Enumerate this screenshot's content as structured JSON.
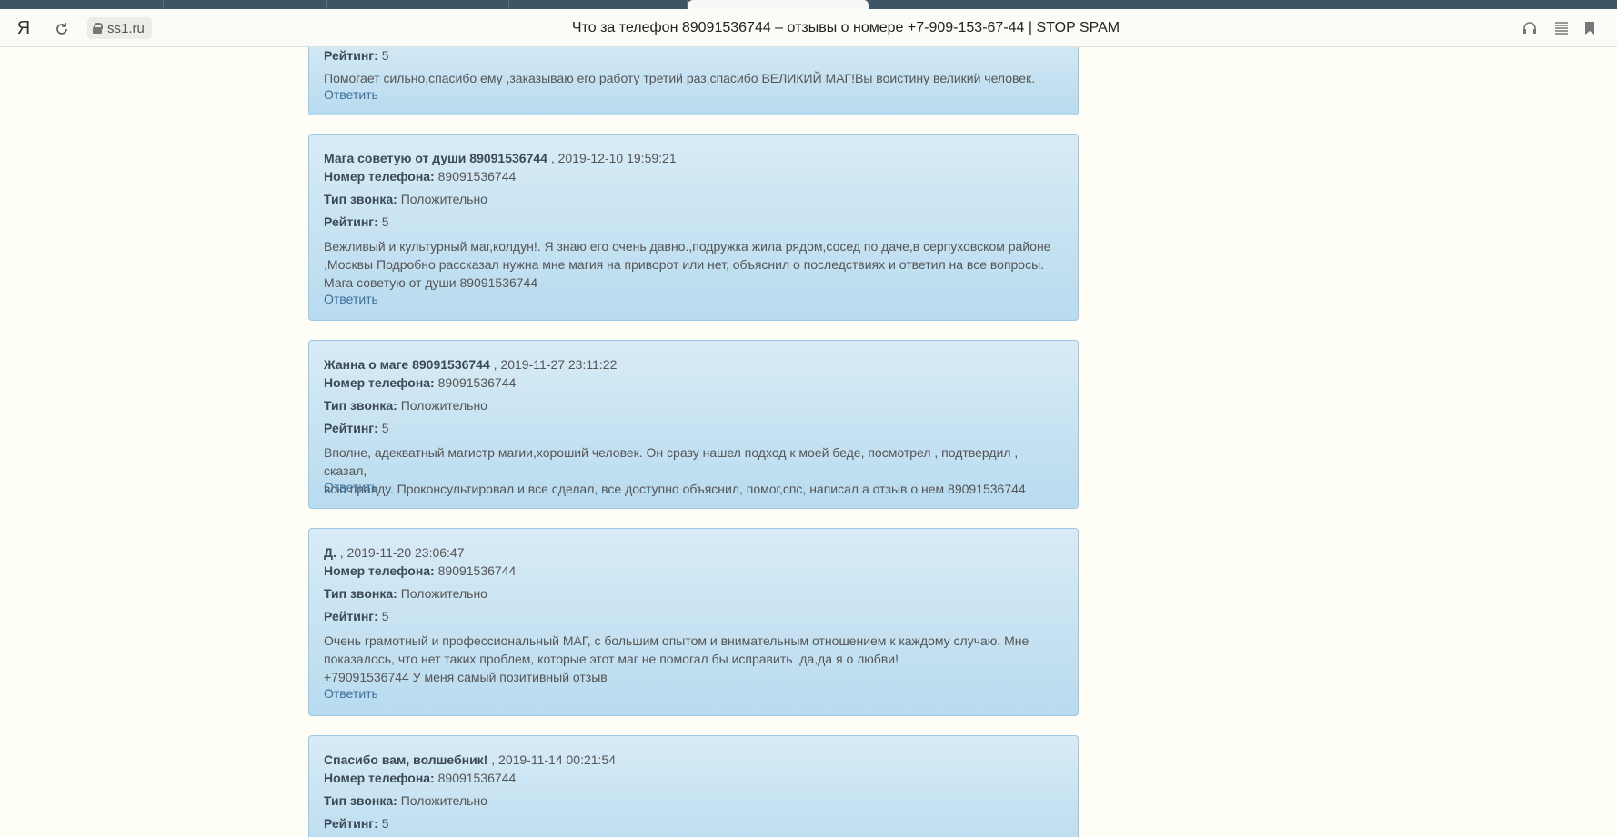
{
  "browser": {
    "logo": "Я",
    "url": "ss1.ru",
    "title": "Что за телефон 89091536744 – отзывы о номере +7-909-153-67-44 | STOP SPAM"
  },
  "labels": {
    "phone": "Номер телефона:",
    "call_type": "Тип звонка:",
    "rating": "Рейтинг:",
    "reply": "Ответить"
  },
  "reviews": [
    {
      "rating": "5",
      "text": "Помогает сильно,спасибо ему ,заказываю его работу третий раз,спасибо ВЕЛИКИЙ МАГ!Вы воистину великий человек."
    },
    {
      "author": "Мага советую от души 89091536744",
      "date": ", 2019-12-10 19:59:21",
      "phone": "89091536744",
      "call_type": "Положительно",
      "rating": "5",
      "text_lines": [
        "Вежливый и культурный маг,колдун!. Я знаю его очень давно.,подружка жила рядом,сосед по даче,в серпуховском районе",
        ",Москвы Подробно рассказал нужна мне магия на приворот или нет, объяснил о последствиях и ответил на все вопросы.",
        "Мага советую от души 89091536744"
      ]
    },
    {
      "author": "Жанна о маге 89091536744",
      "date": ", 2019-11-27 23:11:22",
      "phone": "89091536744",
      "call_type": "Положительно",
      "rating": "5",
      "text_lines": [
        "Вполне, адекватный магистр магии,хороший человек. Он сразу нашел подход к моей беде, посмотрел , подтвердил , сказал,",
        "всю правду. Проконсультировал и все сделал, все доступно объяснил, помог,спс, написал а отзыв о нем 89091536744"
      ]
    },
    {
      "author": "Д.",
      "date": ", 2019-11-20 23:06:47",
      "phone": "89091536744",
      "call_type": "Положительно",
      "rating": "5",
      "text_lines": [
        "Очень грамотный и профессиональный МАГ, с большим опытом и внимательным отношением к каждому случаю. Мне",
        "показалось, что нет таких проблем, которые этот маг не помогал бы исправить ,да,да я о любви!",
        "+79091536744 У меня самый позитивный отзыв"
      ]
    },
    {
      "author": "Спасибо вам, волшебник!",
      "date": ", 2019-11-14 00:21:54",
      "phone": "89091536744",
      "call_type": "Положительно",
      "rating": "5"
    }
  ]
}
